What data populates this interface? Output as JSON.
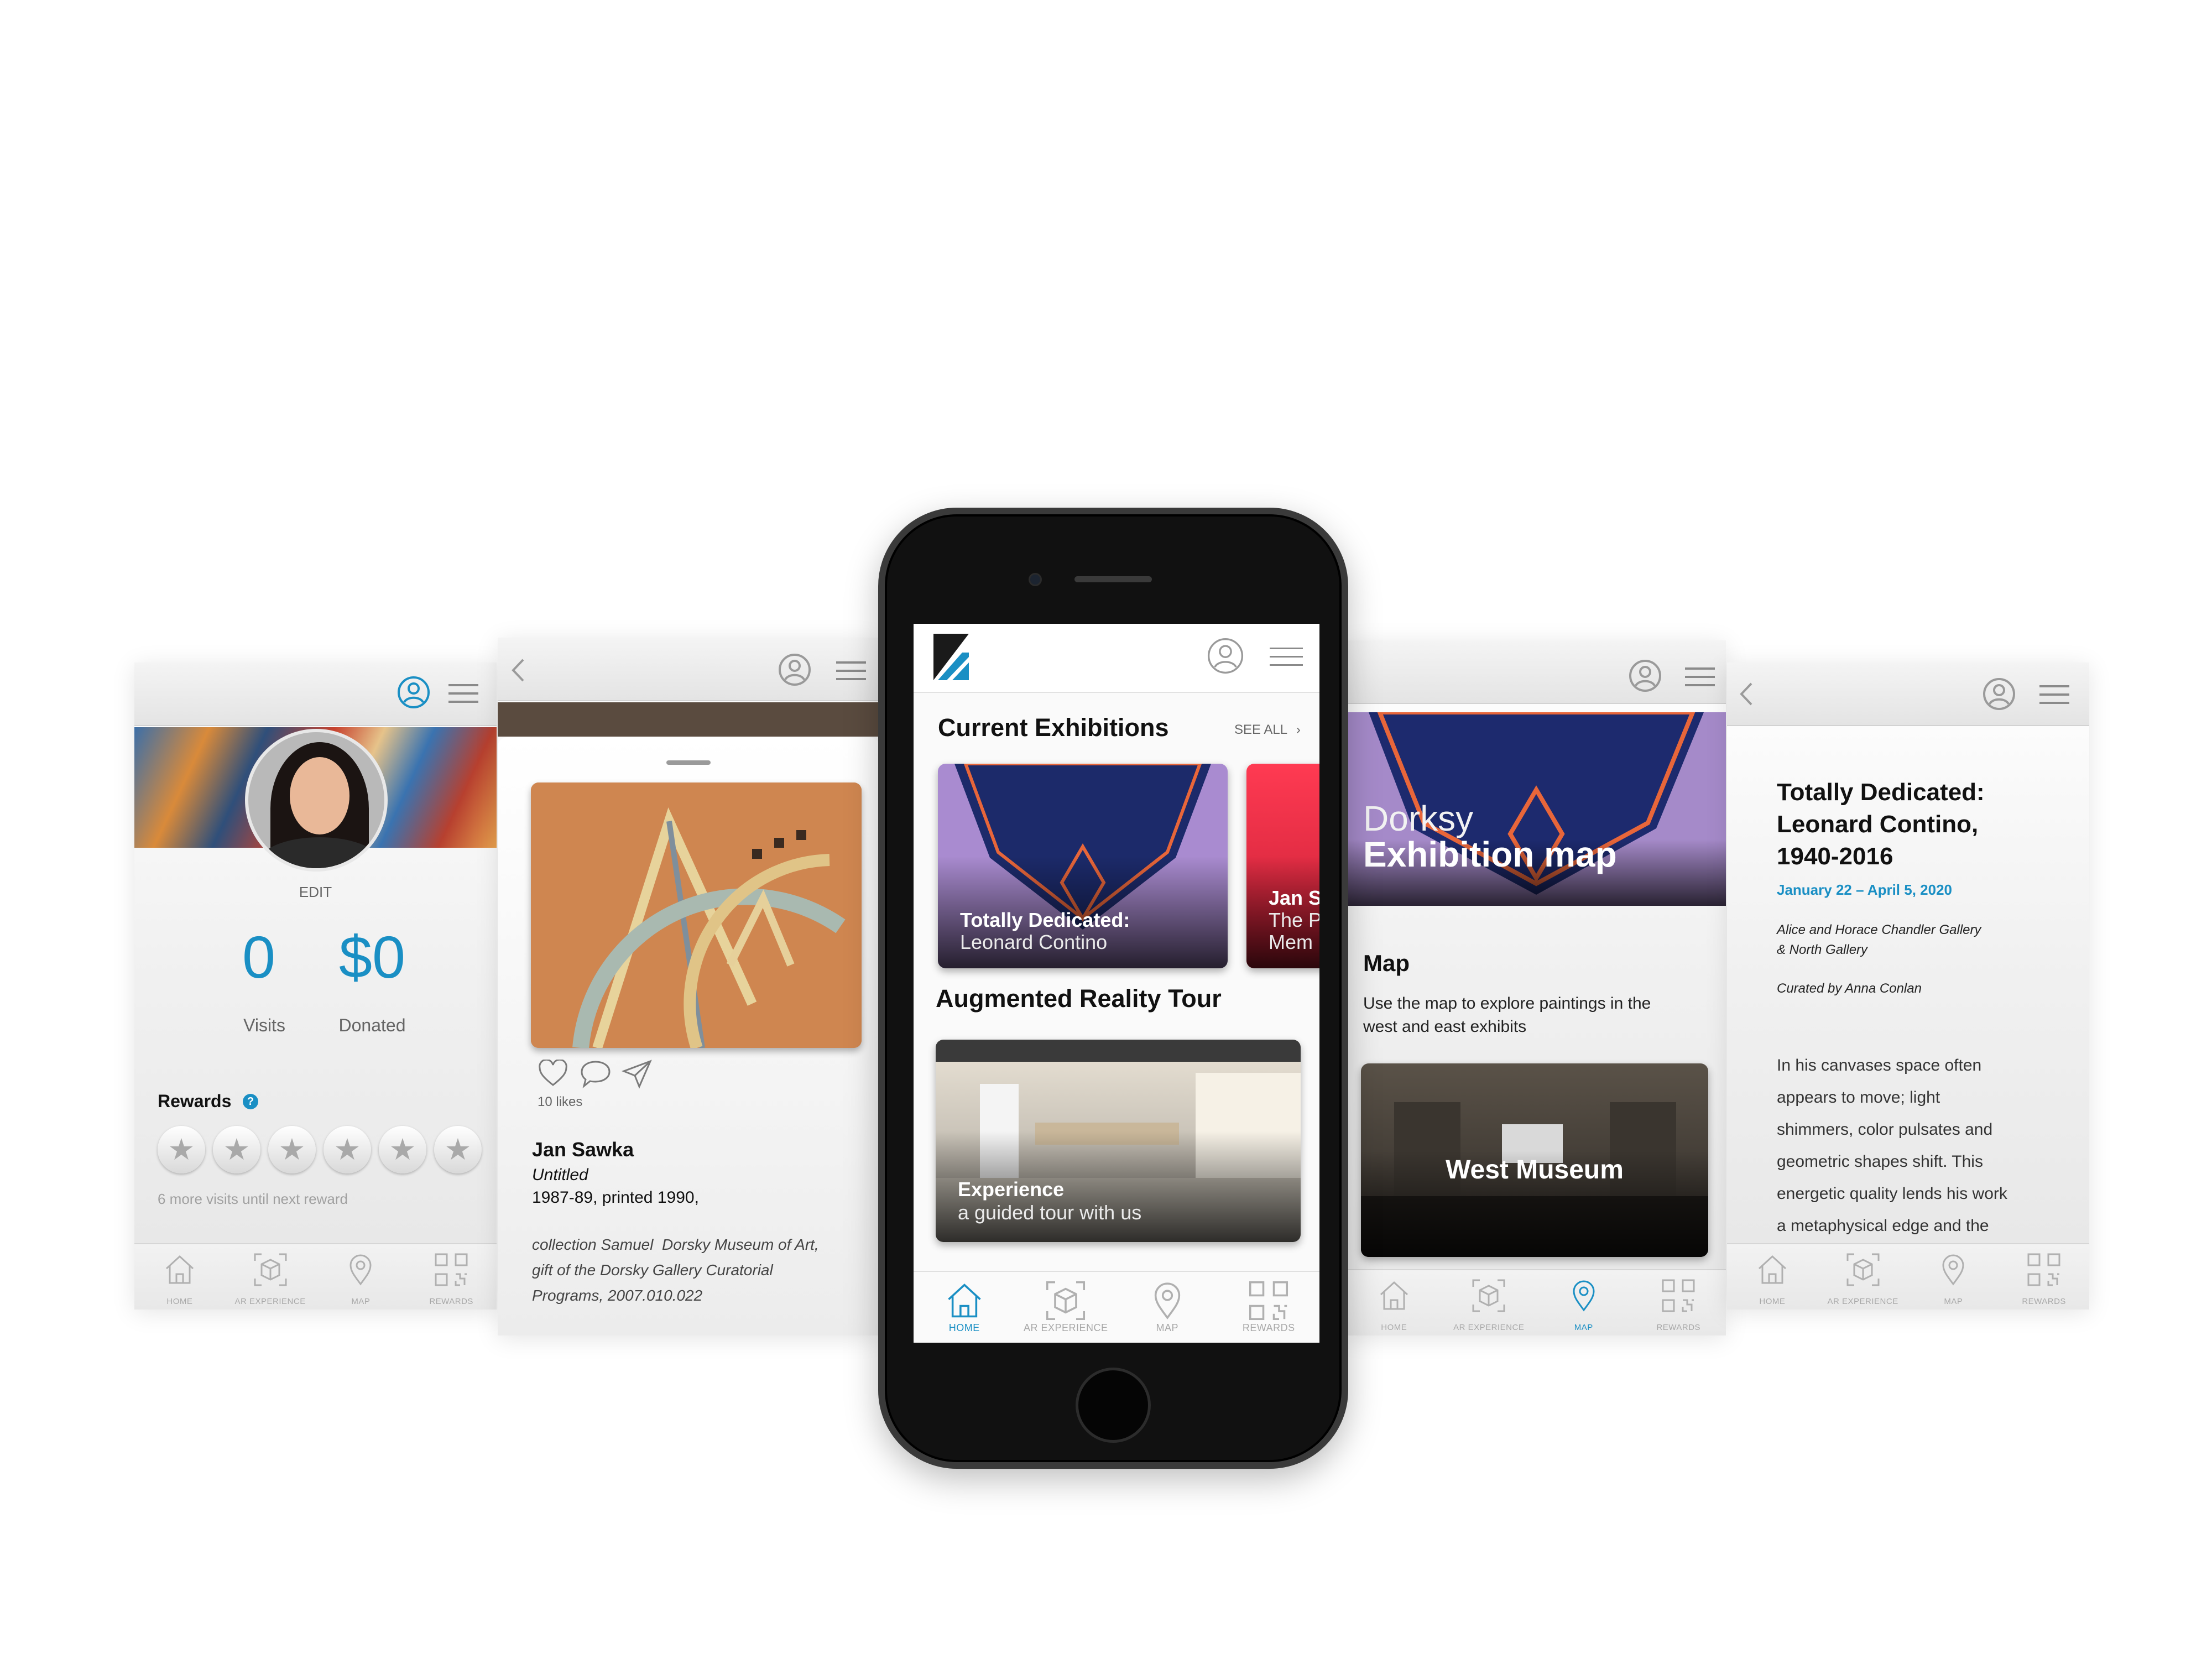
{
  "nav": {
    "home": "HOME",
    "ar": "AR EXPERIENCE",
    "map": "MAP",
    "rewards": "REWARDS"
  },
  "colors": {
    "accent": "#1a8fc4",
    "nav_inactive": "#a8a8a8",
    "text": "#111111"
  },
  "profile": {
    "edit_label": "EDIT",
    "visits_value": "0",
    "visits_label": "Visits",
    "donated_value": "$0",
    "donated_label": "Donated",
    "rewards_title": "Rewards",
    "rewards_help": "?",
    "stars_total": 6,
    "stars_earned": 0,
    "next_reward_text": "6 more visits until next reward"
  },
  "artwork": {
    "likes": "10 likes",
    "artist": "Jan Sawka",
    "title": "Untitled",
    "date": "1987-89, printed 1990,",
    "credit_line1": "collection Samuel  Dorsky Museum of Art,",
    "credit_line2": "gift of the Dorsky Gallery Curatorial",
    "credit_line3": "Programs, 2007.010.022"
  },
  "home": {
    "section1_title": "Current Exhibitions",
    "see_all": "SEE ALL",
    "card1_title": "Totally Dedicated:",
    "card1_sub": "Leonard Contino",
    "card2_title": "Jan Sa",
    "card2_sub1": "The P",
    "card2_sub2": "Mem",
    "section2_title": "Augmented Reality Tour",
    "tour_title": "Experience",
    "tour_sub": "a guided tour with us"
  },
  "map_screen": {
    "hero_light": "Dorksy",
    "hero_bold": "Exhibition map",
    "heading": "Map",
    "desc_line1": "Use the map to explore paintings in the",
    "desc_line2": "west and east exhibits",
    "card_label": "West Museum"
  },
  "exhibition": {
    "title_line1": "Totally Dedicated:",
    "title_line2": "Leonard Contino,",
    "title_line3": "1940-2016",
    "dates": "January 22 – April 5, 2020",
    "gallery_line1": "Alice and Horace Chandler Gallery",
    "gallery_line2": "& North Gallery",
    "curator": "Curated by Anna Conlan",
    "body_line1": "In his canvases space often",
    "body_line2": "appears to move; light",
    "body_line3": "shimmers, color pulsates and",
    "body_line4": "geometric shapes shift. This",
    "body_line5": "energetic quality lends his work",
    "body_line6": "a metaphysical edge and the"
  }
}
